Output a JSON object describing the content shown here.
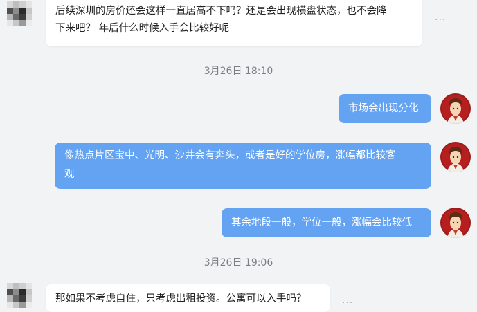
{
  "messages": [
    {
      "side": "left",
      "lines": [
        "后续深圳的房价还会这样一直居高不下吗？还是会出现横盘状态，也不会降",
        "下来吧？ 年后什么时候入手会比较好呢"
      ]
    },
    {
      "side": "time",
      "text": "3月26日 18:10"
    },
    {
      "side": "right",
      "lines": [
        "市场会出现分化"
      ]
    },
    {
      "side": "right",
      "lines": [
        "像热点片区宝中、光明、沙井会有奔头，或者是好的学位房，涨幅都比较客",
        "观"
      ]
    },
    {
      "side": "right",
      "lines": [
        "其余地段一般，学位一般，涨幅会比较低"
      ]
    },
    {
      "side": "time",
      "text": "3月26日 19:06"
    },
    {
      "side": "left",
      "lines": [
        "那如果不考虑自住，只考虑出租投资。公寓可以入手吗？"
      ]
    }
  ],
  "more_icon": "···",
  "icons": {
    "more": "ellipsis-icon",
    "avatar": "agent-avatar"
  },
  "colors": {
    "background": "#f2f3f5",
    "right_bubble": "#64a3f2",
    "left_bubble": "#ffffff"
  }
}
